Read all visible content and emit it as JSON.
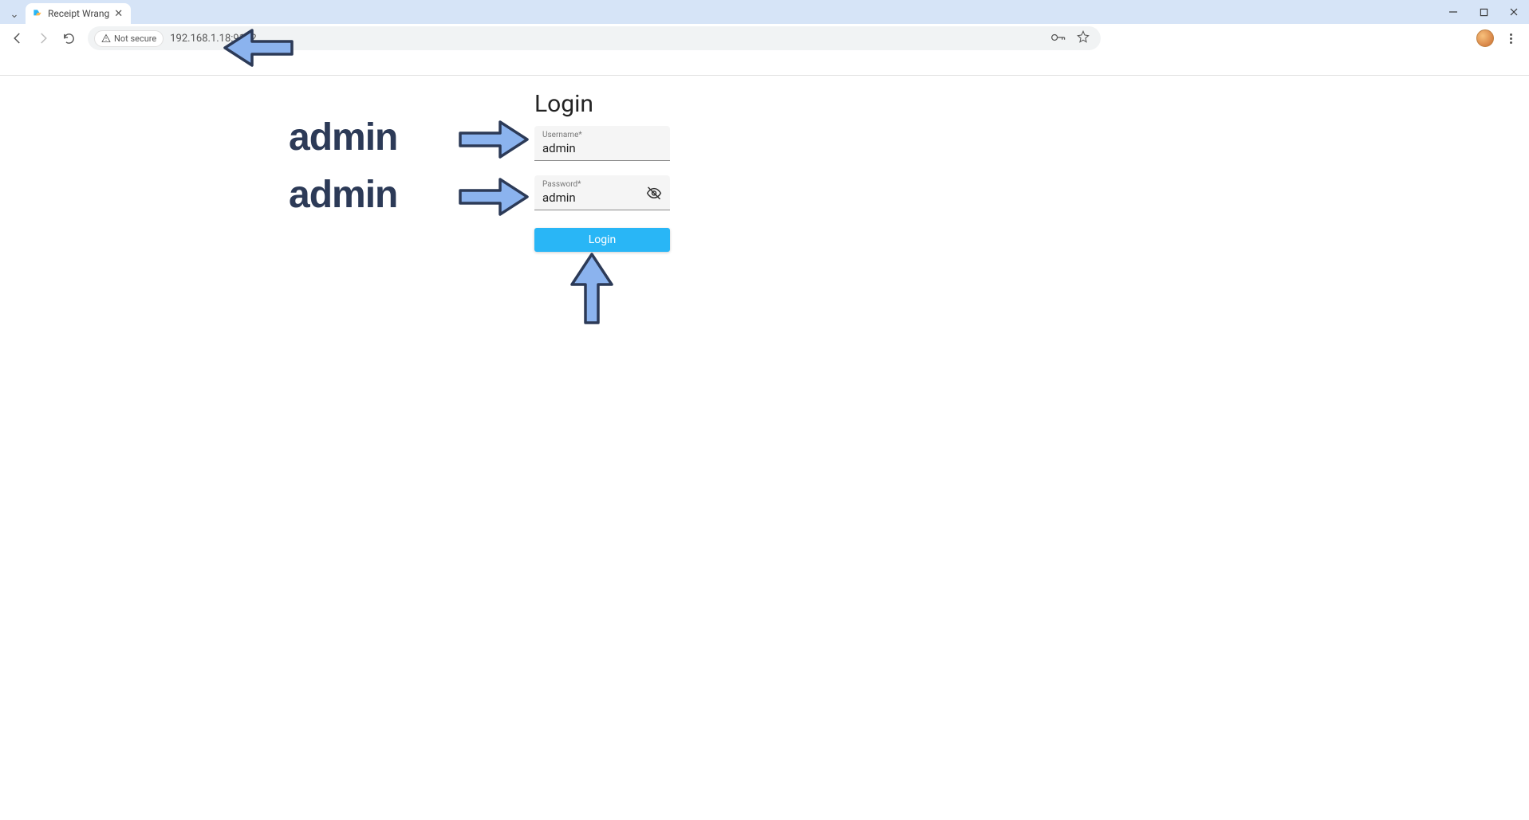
{
  "browser": {
    "tab_title": "Receipt Wrang",
    "security_chip": "Not secure",
    "url": "192.168.1.18:9112"
  },
  "login": {
    "title": "Login",
    "username_label": "Username",
    "username_required_mark": "*",
    "username_value": "admin",
    "password_label": "Password",
    "password_required_mark": "*",
    "password_value": "admin",
    "button_label": "Login"
  },
  "annotations": {
    "username_hint": "admin",
    "password_hint": "admin"
  }
}
